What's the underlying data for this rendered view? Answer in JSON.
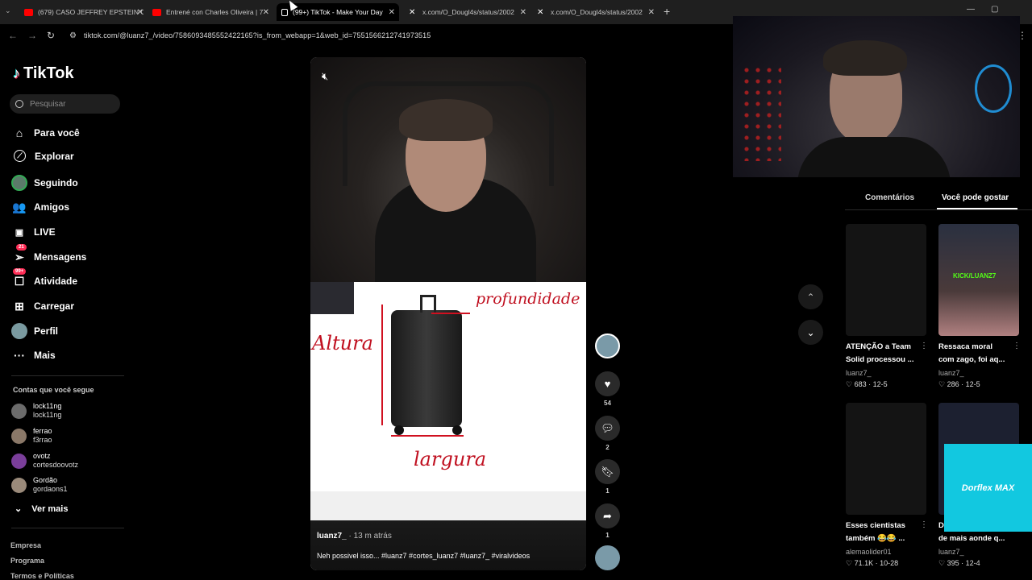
{
  "browser": {
    "tabs": [
      {
        "title": "(679) CASO JEFFREY EPSTEIN C",
        "favicon": "youtube-icon"
      },
      {
        "title": "Entrené con Charles Oliveira | 7",
        "favicon": "youtube-icon"
      },
      {
        "title": "(99+) TikTok - Make Your Day",
        "favicon": "tiktok-icon",
        "active": true
      },
      {
        "title": "x.com/O_Dougl4s/status/2002",
        "favicon": "x-icon"
      },
      {
        "title": "x.com/O_Dougl4s/status/2002",
        "favicon": "x-icon"
      }
    ],
    "url": "tiktok.com/@luanz7_/video/7586093485552422165?is_from_webapp=1&web_id=7551566212741973515"
  },
  "sidebar": {
    "logo": "TikTok",
    "search_placeholder": "Pesquisar",
    "nav": [
      {
        "label": "Para você",
        "icon": "home-icon"
      },
      {
        "label": "Explorar",
        "icon": "compass-icon"
      },
      {
        "label": "Seguindo",
        "icon": "following-avatar-icon"
      },
      {
        "label": "Amigos",
        "icon": "friends-icon"
      },
      {
        "label": "LIVE",
        "icon": "live-icon"
      },
      {
        "label": "Mensagens",
        "icon": "messages-icon",
        "badge": "21"
      },
      {
        "label": "Atividade",
        "icon": "activity-icon",
        "badge": "99+"
      },
      {
        "label": "Carregar",
        "icon": "upload-icon"
      },
      {
        "label": "Perfil",
        "icon": "profile-avatar-icon"
      },
      {
        "label": "Mais",
        "icon": "more-icon"
      }
    ],
    "following_title": "Contas que você segue",
    "following": [
      {
        "name": "lock11ng",
        "handle": "lock11ng"
      },
      {
        "name": "ferrao",
        "handle": "f3rrao"
      },
      {
        "name": "ovotz",
        "handle": "cortesdoovotz"
      },
      {
        "name": "Gordão",
        "handle": "gordaons1"
      }
    ],
    "see_more": "Ver mais",
    "footer": [
      "Empresa",
      "Programa",
      "Termos e Políticas"
    ]
  },
  "video": {
    "author": "luanz7_",
    "time": "· 13 m atrás",
    "description": "Neh possivel isso... #luanz7 #cortes_luanz7 #luanz7_ #viralvideos",
    "whiteboard": {
      "label_height": "Altura",
      "label_depth": "profundidade",
      "label_width": "largura"
    }
  },
  "actions": {
    "likes": "54",
    "comments": "2",
    "saves": "1",
    "shares": "1"
  },
  "right_panel": {
    "tabs": [
      "Comentários",
      "Você pode gostar"
    ],
    "cards": [
      {
        "title_line1": "ATENÇÃO a Team",
        "title_line2": "Solid processou ...",
        "user": "luanz7_",
        "likes": "683",
        "date": "12-5"
      },
      {
        "title_line1": "Ressaca moral",
        "title_line2": "com zago, foi aq...",
        "user": "luanz7_",
        "likes": "286",
        "date": "12-5"
      },
      {
        "title_line1": "Esses cientistas",
        "title_line2": "também 😂😂 ...",
        "user": "alemaolider01",
        "likes": "71.1K",
        "date": "10-28"
      },
      {
        "title_line1": "D",
        "title_line2": "de mais aonde q...",
        "user": "luanz7_",
        "likes": "395",
        "date": "12-4"
      }
    ]
  },
  "overlay_ad": "Dorflex MAX",
  "colors": {
    "accent": "#fe2c55",
    "bg": "#000000",
    "ad": "#12c8e0"
  }
}
